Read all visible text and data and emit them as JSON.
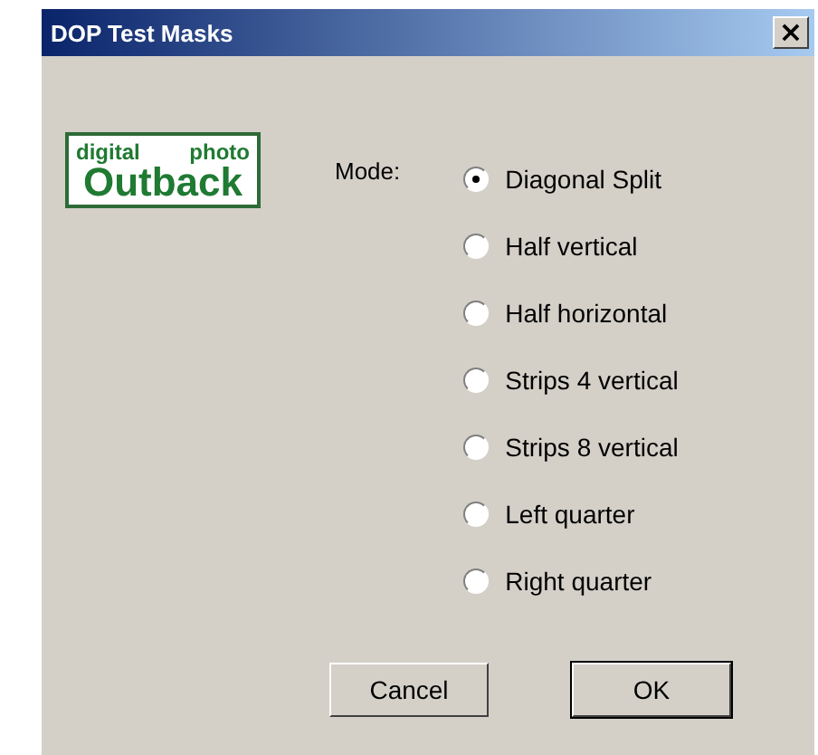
{
  "window": {
    "title": "DOP Test Masks",
    "close": "×"
  },
  "logo": {
    "top_words": [
      "digital",
      "photo"
    ],
    "bottom": "Outback"
  },
  "mode_label": "Mode:",
  "options": [
    {
      "label": "Diagonal Split",
      "selected": true
    },
    {
      "label": "Half vertical",
      "selected": false
    },
    {
      "label": "Half horizontal",
      "selected": false
    },
    {
      "label": "Strips 4 vertical",
      "selected": false
    },
    {
      "label": "Strips 8 vertical",
      "selected": false
    },
    {
      "label": "Left quarter",
      "selected": false
    },
    {
      "label": "Right quarter",
      "selected": false
    }
  ],
  "buttons": [
    {
      "label": "Cancel",
      "default": false
    },
    {
      "label": "OK",
      "default": true
    }
  ]
}
